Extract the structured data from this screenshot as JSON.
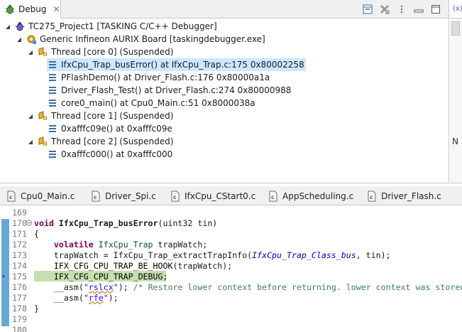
{
  "debug_view": {
    "tab_label": "Debug",
    "tree": [
      {
        "label": "TC275_Project1 [TASKING C/C++ Debugger]",
        "icon": "launch-config-icon",
        "level": 0,
        "expanded": true
      },
      {
        "label": "Generic Infineon AURIX Board [taskingdebugger.exe]",
        "icon": "debug-target-icon",
        "level": 1,
        "expanded": true
      },
      {
        "label": "Thread [core 0] (Suspended)",
        "icon": "thread-suspended-icon",
        "level": 2,
        "expanded": true
      },
      {
        "label": "IfxCpu_Trap_busError() at IfxCpu_Trap.c:175 0x80002258",
        "icon": "stack-frame-icon",
        "level": 3,
        "selected": true
      },
      {
        "label": "PFlashDemo() at Driver_Flash.c:176 0x80000a1a",
        "icon": "stack-frame-icon",
        "level": 3
      },
      {
        "label": "Driver_Flash_Test() at Driver_Flash.c:274 0x80000988",
        "icon": "stack-frame-icon",
        "level": 3
      },
      {
        "label": "core0_main() at Cpu0_Main.c:51 0x8000038a",
        "icon": "stack-frame-icon",
        "level": 3
      },
      {
        "label": "Thread [core 1] (Suspended)",
        "icon": "thread-suspended-icon",
        "level": 2,
        "expanded": true
      },
      {
        "label": "0xafffc09e() at 0xafffc09e",
        "icon": "stack-frame-icon",
        "level": 3
      },
      {
        "label": "Thread [core 2] (Suspended)",
        "icon": "thread-suspended-icon",
        "level": 2,
        "expanded": true
      },
      {
        "label": "0xafffc000() at 0xafffc000",
        "icon": "stack-frame-icon",
        "level": 3
      }
    ]
  },
  "variables_view": {
    "tab_label": "(x)=",
    "side_letter": "N"
  },
  "editor": {
    "tabs": [
      {
        "label": "Cpu0_Main.c",
        "active": false
      },
      {
        "label": "Driver_Spi.c",
        "active": false
      },
      {
        "label": "IfxCpu_CStart0.c",
        "active": false
      },
      {
        "label": "AppScheduling.c",
        "active": false
      },
      {
        "label": "Driver_Flash.c",
        "active": false
      }
    ],
    "current_line": 175,
    "lines": [
      {
        "no": "169",
        "text": ""
      },
      {
        "no": "170",
        "text": "void IfxCpu_Trap_busError(uint32 tin)"
      },
      {
        "no": "171",
        "text": "{"
      },
      {
        "no": "172",
        "text": "    volatile IfxCpu_Trap trapWatch;"
      },
      {
        "no": "173",
        "text": "    trapWatch = IfxCpu_Trap_extractTrapInfo(IfxCpu_Trap_Class_bus, tin);"
      },
      {
        "no": "174",
        "text": "    IFX_CFG_CPU_TRAP_BE_HOOK(trapWatch);"
      },
      {
        "no": "175",
        "text": "    IFX_CFG_CPU_TRAP_DEBUG;"
      },
      {
        "no": "176",
        "text": "    __asm(\"rslcx\"); /* Restore lower context before returning. lower context was stored"
      },
      {
        "no": "177",
        "text": "    __asm(\"rfe\");"
      },
      {
        "no": "178",
        "text": "}"
      },
      {
        "no": "179",
        "text": ""
      },
      {
        "no": "180",
        "text": ""
      }
    ]
  },
  "colors": {
    "selection": "#cde8ff",
    "current_line_highlight": "#c6dfb1",
    "keyword": "#7f0055",
    "comment": "#3f7f5f",
    "string": "#2a00ff",
    "gutter_strip": "#6aa7d6"
  }
}
